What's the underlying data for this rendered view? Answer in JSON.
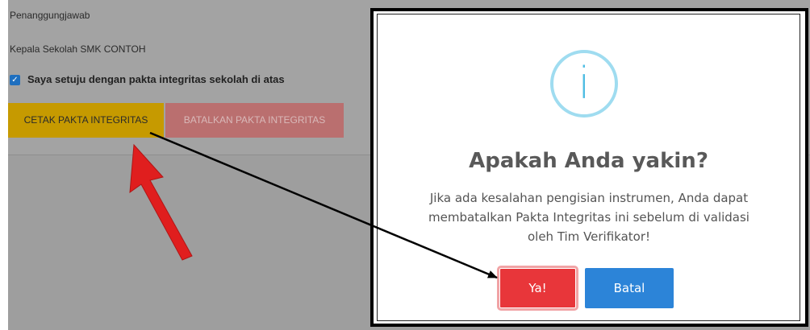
{
  "form": {
    "penanggungjawab_label": "Penanggungjawab",
    "penanggungjawab_value": "Kepala Sekolah SMK CONTOH",
    "agree_checkbox": {
      "checked": true,
      "label": "Saya setuju dengan pakta integritas sekolah di atas"
    },
    "print_button": "CETAK PAKTA INTEGRITAS",
    "cancel_pact_button": "BATALKAN PAKTA INTEGRITAS"
  },
  "dialog": {
    "icon": "info-icon",
    "icon_glyph": "i",
    "title": "Apakah Anda yakin?",
    "message_lines": [
      "Jika ada kesalahan pengisian instrumen, Anda dapat",
      "membatalkan Pakta Integritas ini sebelum di validasi",
      "oleh Tim Verifikator!"
    ],
    "confirm_button": "Ya!",
    "cancel_button": "Batal"
  },
  "colors": {
    "print_button": "#c69a00",
    "cancel_pact_button": "#ba6f6f",
    "confirm_button": "#e8363a",
    "cancel_button": "#2c84d8",
    "annotation_arrow": "#e01e1e"
  }
}
